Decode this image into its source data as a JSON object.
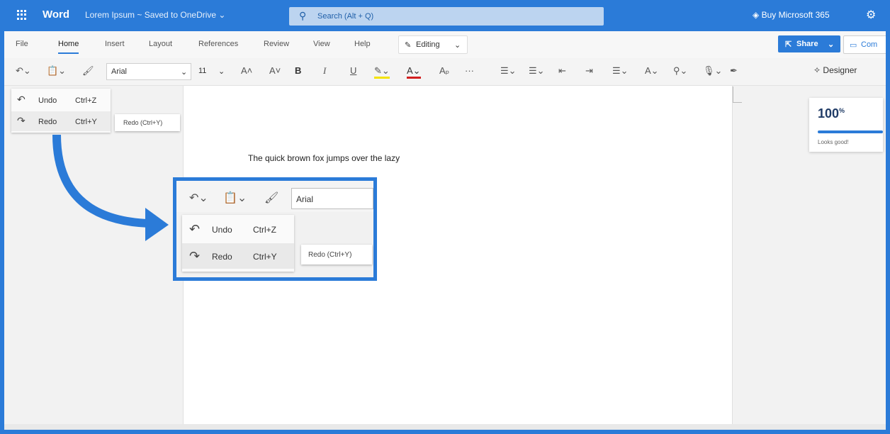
{
  "titlebar": {
    "app_name": "Word",
    "document_title": "Lorem Ipsum ~ Saved to OneDrive ⌄",
    "search_placeholder": "Search (Alt + Q)",
    "buy_label": "Buy Microsoft 365"
  },
  "tabs": {
    "items": [
      {
        "label": "File"
      },
      {
        "label": "Home",
        "active": true
      },
      {
        "label": "Insert"
      },
      {
        "label": "Layout"
      },
      {
        "label": "References"
      },
      {
        "label": "Review"
      },
      {
        "label": "View"
      },
      {
        "label": "Help"
      }
    ],
    "editing_label": "Editing",
    "share_label": "Share",
    "comments_label": "Com"
  },
  "ribbon": {
    "font_name": "Arial",
    "font_size": "11",
    "designer_label": "Designer"
  },
  "undo_menu": {
    "undo_label": "Undo",
    "undo_shortcut": "Ctrl+Z",
    "redo_label": "Redo",
    "redo_shortcut": "Ctrl+Y",
    "redo_tooltip": "Redo (Ctrl+Y)"
  },
  "document": {
    "text": "The quick brown fox jumps over the lazy"
  },
  "editor_score": {
    "value": "100",
    "unit": "%",
    "label": "Looks good!"
  },
  "zoom_inset": {
    "font_name": "Arial",
    "undo_label": "Undo",
    "undo_shortcut": "Ctrl+Z",
    "redo_label": "Redo",
    "redo_shortcut": "Ctrl+Y",
    "redo_tooltip": "Redo (Ctrl+Y)"
  },
  "colors": {
    "accent": "#2b7bd8",
    "ribbon_bg": "#f4f4f4",
    "canvas_bg": "#f2f2f2"
  }
}
